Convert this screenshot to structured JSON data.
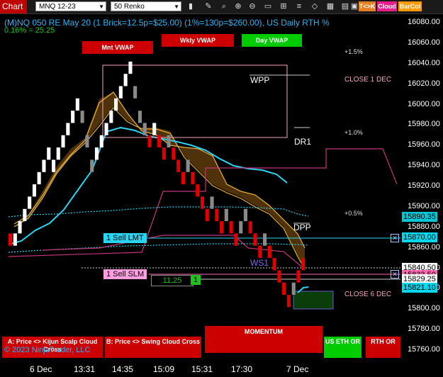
{
  "toolbar": {
    "title": "Chart",
    "instrument": "MNQ 12-23",
    "bar_type": "50 Renko",
    "icons": [
      "bar-type-icon",
      "pencil-icon",
      "magnifier-icon",
      "zoom-in-icon",
      "zoom-out-icon",
      "screen-icon",
      "grid-icon",
      "properties-icon",
      "drawing-objects-icon",
      "instruments-icon",
      "data-box-icon",
      "window-icon"
    ],
    "tk_label": "T<>K",
    "cloud_label": "Cloud",
    "barcol_label": "BarCol",
    "tk_color": "#e67e22",
    "cloud_color": "#e91e8c",
    "barcol_color": "#ff9900"
  },
  "header": {
    "line1": "(M)NQ 050 RE May 20 (1 Brick=12.5p=$25.00) (1%=130p=$260.00), US Daily RTH %",
    "line2": "0.16% = 25.25"
  },
  "vwap": {
    "monthly": "Mnt VWAP",
    "weekly": "Wkly VWAP",
    "daily": "Day VWAP"
  },
  "pct_labels": [
    "+1.5%",
    "+1.0%",
    "+0.5%"
  ],
  "close_labels": [
    "CLOSE 1 DEC",
    "CLOSE 6 DEC"
  ],
  "pivots": {
    "wpp": "WPP",
    "dr1": "DR1",
    "dpp": "DPP",
    "ws1": "WS1"
  },
  "orders": {
    "sell_lmt": "1 Sell LMT",
    "sell_slm": "1 Sell SLM",
    "pnl": "11.25",
    "qty": "1"
  },
  "price_axis": [
    "16080.00",
    "16060.00",
    "16040.00",
    "16020.00",
    "16000.00",
    "15980.00",
    "15960.00",
    "15940.00",
    "15920.00",
    "15900.00",
    "15880.00",
    "15860.00",
    "15840.00",
    "15820.00",
    "15800.00",
    "15780.00",
    "15760.00"
  ],
  "price_tags": [
    {
      "value": "15890.35",
      "bg": "#00c8d8",
      "fg": "#000"
    },
    {
      "value": "15870.00",
      "bg": "#00d8f0",
      "fg": "#000"
    },
    {
      "value": "15840.50",
      "bg": "#ffffff",
      "fg": "#000"
    },
    {
      "value": "15833.50",
      "bg": "#ff69b4",
      "fg": "#000"
    },
    {
      "value": "15829.25",
      "bg": "#ffffff",
      "fg": "#000"
    },
    {
      "value": "15821.10",
      "bg": "#00d8f0",
      "fg": "#000"
    }
  ],
  "time_axis": [
    "6 Dec",
    "13:31",
    "14:35",
    "15:09",
    "15:31",
    "17:30",
    "7 Dec"
  ],
  "bottom_buttons": {
    "kijun": "A: Price <> Kijun Scalp Cloud Cross",
    "swing": "B: Price <> Swing Cloud Cross",
    "momentum": "MOMENTUM",
    "us_eth": "US ETH OR",
    "rth": "RTH OR"
  },
  "copyright": "© 2023 NinjaTrader, LLC",
  "chart_data": {
    "type": "renko",
    "brick_size": 12.5,
    "ylim": [
      15750,
      16090
    ],
    "bricks": [
      {
        "o": 15862,
        "c": 15874,
        "col": "red"
      },
      {
        "o": 15862,
        "c": 15874,
        "col": "white"
      },
      {
        "o": 15874,
        "c": 15886,
        "col": "white"
      },
      {
        "o": 15886,
        "c": 15898,
        "col": "white"
      },
      {
        "o": 15898,
        "c": 15910,
        "col": "white"
      },
      {
        "o": 15910,
        "c": 15922,
        "col": "white"
      },
      {
        "o": 15922,
        "c": 15934,
        "col": "white"
      },
      {
        "o": 15934,
        "c": 15946,
        "col": "white"
      },
      {
        "o": 15946,
        "c": 15958,
        "col": "white"
      },
      {
        "o": 15934,
        "c": 15946,
        "col": "white"
      },
      {
        "o": 15946,
        "c": 15958,
        "col": "white"
      },
      {
        "o": 15958,
        "c": 15970,
        "col": "white"
      },
      {
        "o": 15970,
        "c": 15982,
        "col": "white"
      },
      {
        "o": 15982,
        "c": 15994,
        "col": "white"
      },
      {
        "o": 15994,
        "c": 16006,
        "col": "white"
      },
      {
        "o": 15982,
        "c": 15994,
        "col": "gray"
      },
      {
        "o": 15958,
        "c": 15970,
        "col": "gray"
      },
      {
        "o": 15934,
        "c": 15946,
        "col": "gray"
      },
      {
        "o": 15946,
        "c": 15958,
        "col": "white"
      },
      {
        "o": 15958,
        "c": 15970,
        "col": "white"
      },
      {
        "o": 15970,
        "c": 15982,
        "col": "white"
      },
      {
        "o": 15982,
        "c": 15994,
        "col": "white"
      },
      {
        "o": 15994,
        "c": 16006,
        "col": "white"
      },
      {
        "o": 16006,
        "c": 16018,
        "col": "white"
      },
      {
        "o": 16018,
        "c": 16030,
        "col": "white"
      },
      {
        "o": 16030,
        "c": 16042,
        "col": "white"
      },
      {
        "o": 16006,
        "c": 16018,
        "col": "gray"
      },
      {
        "o": 15982,
        "c": 15994,
        "col": "gray"
      },
      {
        "o": 15970,
        "c": 15982,
        "col": "gray"
      },
      {
        "o": 15958,
        "c": 15970,
        "col": "red"
      },
      {
        "o": 15970,
        "c": 15982,
        "col": "white"
      },
      {
        "o": 15958,
        "c": 15970,
        "col": "red"
      },
      {
        "o": 15946,
        "c": 15958,
        "col": "red"
      },
      {
        "o": 15958,
        "c": 15970,
        "col": "gray"
      },
      {
        "o": 15946,
        "c": 15958,
        "col": "red"
      },
      {
        "o": 15934,
        "c": 15946,
        "col": "red"
      },
      {
        "o": 15922,
        "c": 15934,
        "col": "red"
      },
      {
        "o": 15934,
        "c": 15946,
        "col": "gray"
      },
      {
        "o": 15922,
        "c": 15934,
        "col": "red"
      },
      {
        "o": 15910,
        "c": 15922,
        "col": "red"
      },
      {
        "o": 15898,
        "c": 15910,
        "col": "red"
      },
      {
        "o": 15886,
        "c": 15898,
        "col": "red"
      },
      {
        "o": 15898,
        "c": 15910,
        "col": "gray"
      },
      {
        "o": 15886,
        "c": 15898,
        "col": "red"
      },
      {
        "o": 15874,
        "c": 15886,
        "col": "red"
      },
      {
        "o": 15886,
        "c": 15898,
        "col": "gray"
      },
      {
        "o": 15874,
        "c": 15886,
        "col": "red"
      },
      {
        "o": 15862,
        "c": 15874,
        "col": "red"
      },
      {
        "o": 15874,
        "c": 15886,
        "col": "gray"
      },
      {
        "o": 15886,
        "c": 15898,
        "col": "gray"
      },
      {
        "o": 15874,
        "c": 15886,
        "col": "red"
      },
      {
        "o": 15862,
        "c": 15874,
        "col": "red"
      },
      {
        "o": 15850,
        "c": 15862,
        "col": "red"
      },
      {
        "o": 15862,
        "c": 15874,
        "col": "gray"
      },
      {
        "o": 15850,
        "c": 15862,
        "col": "red"
      },
      {
        "o": 15838,
        "c": 15850,
        "col": "red"
      },
      {
        "o": 15826,
        "c": 15838,
        "col": "red"
      },
      {
        "o": 15814,
        "c": 15826,
        "col": "red"
      },
      {
        "o": 15802,
        "c": 15814,
        "col": "red"
      },
      {
        "o": 15814,
        "c": 15826,
        "col": "gray"
      },
      {
        "o": 15826,
        "c": 15838,
        "col": "red"
      },
      {
        "o": 15838,
        "c": 15850,
        "col": "red"
      }
    ]
  }
}
